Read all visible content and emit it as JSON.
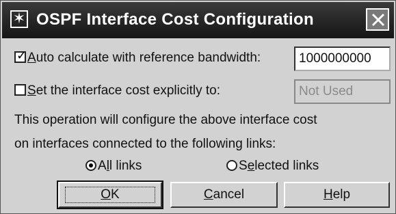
{
  "window": {
    "title": "OSPF Interface Cost Configuration",
    "icon": "star-icon",
    "close_icon": "close-icon"
  },
  "auto_calculate": {
    "checked": true,
    "label_mnemonic": "A",
    "label_rest": "uto calculate with reference bandwidth:",
    "value": "1000000000"
  },
  "explicit_cost": {
    "checked": false,
    "label_mnemonic": "S",
    "label_rest": "et the interface cost explicitly to:",
    "value": "Not Used"
  },
  "info": {
    "line1": "This operation will configure the above interface cost",
    "line2": "on interfaces connected to the following links:"
  },
  "links": {
    "all": {
      "selected": true,
      "label_prefix": "A",
      "label_mnemonic": "l",
      "label_rest": "l links"
    },
    "selected": {
      "selected": false,
      "label_prefix": "S",
      "label_mnemonic": "e",
      "label_rest": "lected links"
    }
  },
  "buttons": {
    "ok": {
      "mnemonic": "O",
      "rest": "K"
    },
    "cancel": {
      "mnemonic": "C",
      "rest": "ancel"
    },
    "help": {
      "mnemonic": "H",
      "rest": "elp"
    }
  },
  "colors": {
    "titlebar": "#151515",
    "dialog_bg": "#d2d2d2",
    "disabled_text": "#8a8a8a"
  }
}
